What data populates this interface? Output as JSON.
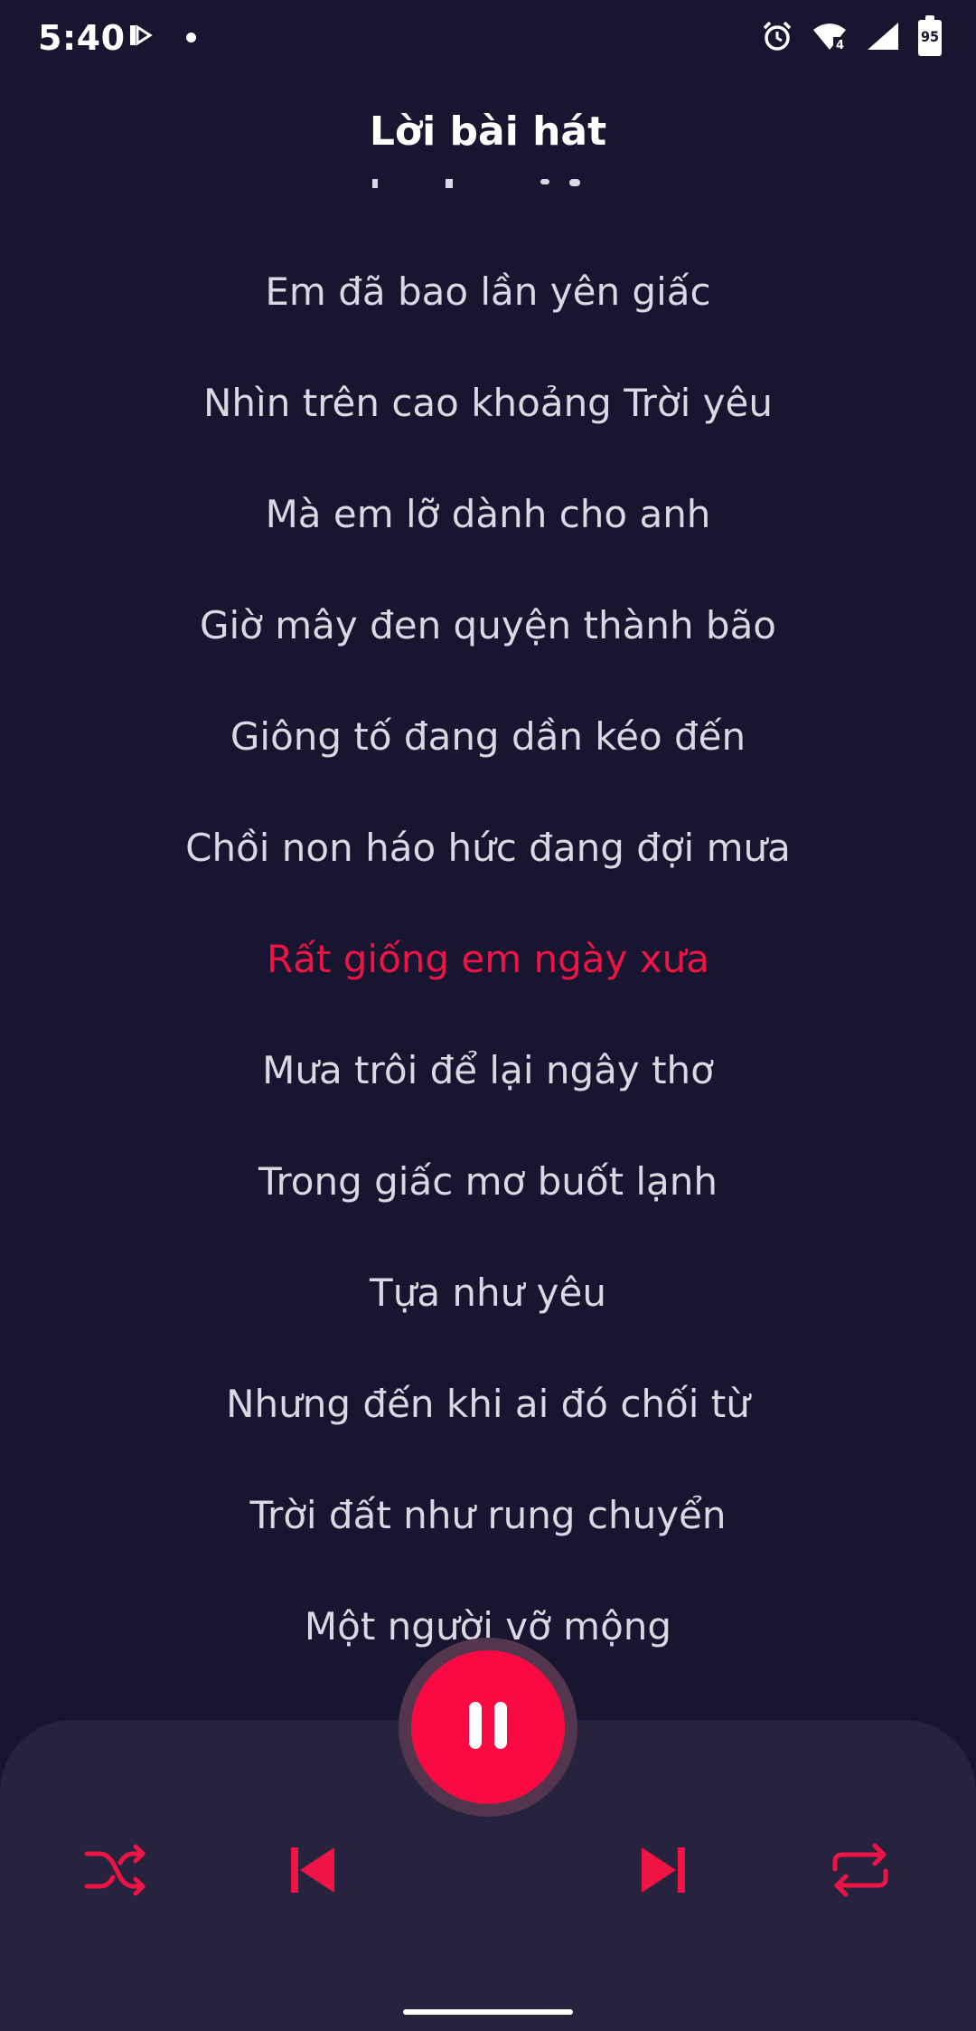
{
  "status_bar": {
    "time": "5:40",
    "battery_level": "95",
    "icons": [
      "media-app-icon",
      "notification-dot-icon",
      "alarm-icon",
      "wifi-icon",
      "cellular-signal-icon",
      "battery-icon"
    ]
  },
  "header": {
    "title": "Lời bài hát"
  },
  "lyrics": {
    "lines": [
      "Em đã bao lần yên giấc",
      "Nhìn trên cao khoảng Trời yêu",
      "Mà em lỡ dành cho anh",
      "Giờ mây đen quyện thành bão",
      "Giông tố đang dần kéo đến",
      "Chồi non háo hức đang đợi mưa",
      "Rất giống em ngày xưa",
      "Mưa trôi để lại ngây thơ",
      "Trong giấc mơ buốt lạnh",
      "Tựa như yêu",
      "Nhưng đến khi ai đó chối từ",
      "Trời đất như rung chuyển",
      "Một người vỡ mộng"
    ],
    "active_index": 6
  },
  "player": {
    "state": "playing",
    "icons": {
      "shuffle": "shuffle-icon",
      "previous": "skip-previous-icon",
      "play_pause": "pause-icon",
      "next": "skip-next-icon",
      "repeat": "repeat-icon"
    }
  },
  "colors": {
    "background": "#17152f",
    "panel": "#27233f",
    "accent": "#fa0a43",
    "active_lyric": "#ee1446",
    "lyric_text": "#d9d8e3"
  }
}
